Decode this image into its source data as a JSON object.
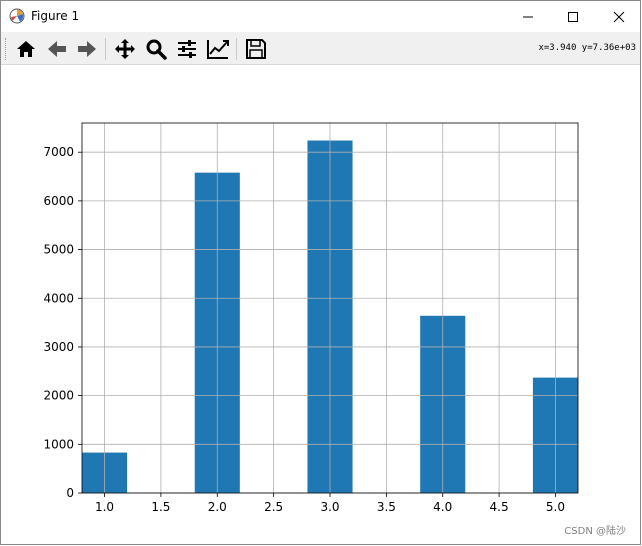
{
  "window": {
    "title": "Figure 1",
    "icon": "matplotlib-icon",
    "controls": [
      "minimize-icon",
      "maximize-icon",
      "close-icon"
    ]
  },
  "toolbar": {
    "buttons": [
      "home-icon",
      "back-icon",
      "forward-icon",
      "pan-icon",
      "zoom-icon",
      "configure-subplots-icon",
      "edit-axis-icon",
      "save-icon"
    ],
    "coordinates": "x=3.940  y=7.36e+03"
  },
  "watermark": "CSDN @陆沙",
  "colors": {
    "bar": "#1f77b4",
    "grid": "#b0b0b0"
  },
  "chart_data": {
    "type": "bar",
    "title": "",
    "xlabel": "",
    "ylabel": "",
    "xlim": [
      0.8,
      5.2
    ],
    "ylim": [
      0,
      7600
    ],
    "grid": true,
    "bar_width": 0.4,
    "x": [
      1.2,
      2.2,
      3.2,
      4.2,
      5.2
    ],
    "values": [
      830,
      6580,
      7240,
      3640,
      2370
    ],
    "xticks": [
      1.0,
      1.5,
      2.0,
      2.5,
      3.0,
      3.5,
      4.0,
      4.5,
      5.0
    ],
    "xtick_labels": [
      "1.0",
      "1.5",
      "2.0",
      "2.5",
      "3.0",
      "3.5",
      "4.0",
      "4.5",
      "5.0"
    ],
    "yticks": [
      0,
      1000,
      2000,
      3000,
      4000,
      5000,
      6000,
      7000
    ],
    "ytick_labels": [
      "0",
      "1000",
      "2000",
      "3000",
      "4000",
      "5000",
      "6000",
      "7000"
    ]
  }
}
